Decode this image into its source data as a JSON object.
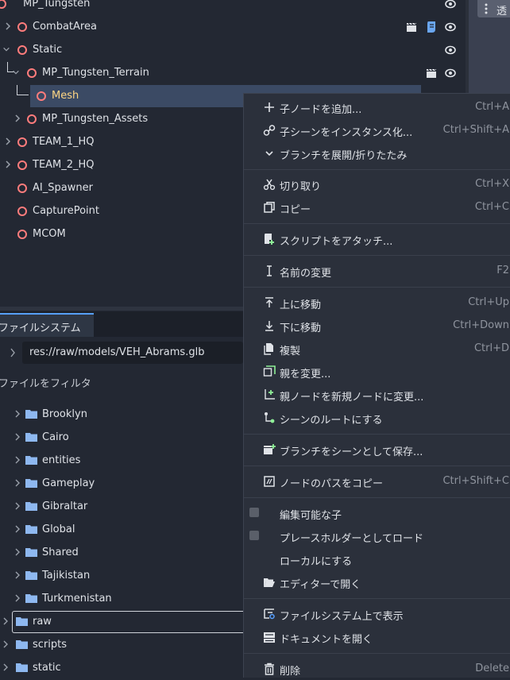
{
  "scene_tree": {
    "nodes": [
      {
        "label": "MP_Tungsten"
      },
      {
        "label": "CombatArea"
      },
      {
        "label": "Static"
      },
      {
        "label": "MP_Tungsten_Terrain"
      },
      {
        "label": "Mesh"
      },
      {
        "label": "MP_Tungsten_Assets"
      },
      {
        "label": "TEAM_1_HQ"
      },
      {
        "label": "TEAM_2_HQ"
      },
      {
        "label": "AI_Spawner"
      },
      {
        "label": "CapturePoint"
      },
      {
        "label": "MCOM"
      }
    ],
    "sliver_tab_label": "透"
  },
  "filesystem": {
    "tab_label": "ファイルシステム",
    "path": "res://raw/models/VEH_Abrams.glb",
    "filter_placeholder": "ファイルをフィルタ",
    "folders": [
      {
        "label": "Brooklyn"
      },
      {
        "label": "Cairo"
      },
      {
        "label": "entities"
      },
      {
        "label": "Gameplay"
      },
      {
        "label": "Gibraltar"
      },
      {
        "label": "Global"
      },
      {
        "label": "Shared"
      },
      {
        "label": "Tajikistan"
      },
      {
        "label": "Turkmenistan"
      },
      {
        "label": "raw"
      },
      {
        "label": "scripts"
      },
      {
        "label": "static"
      }
    ]
  },
  "context_menu": {
    "items": [
      {
        "label": "子ノードを追加...",
        "shortcut": "Ctrl+A",
        "icon": "plus-icon"
      },
      {
        "label": "子シーンをインスタンス化...",
        "shortcut": "Ctrl+Shift+A",
        "icon": "link-icon"
      },
      {
        "label": "ブランチを展開/折りたたみ",
        "shortcut": "",
        "icon": "chevron-down-icon"
      },
      {
        "label": "切り取り",
        "shortcut": "Ctrl+X",
        "icon": "scissors-icon"
      },
      {
        "label": "コピー",
        "shortcut": "Ctrl+C",
        "icon": "copy-icon"
      },
      {
        "label": "スクリプトをアタッチ...",
        "shortcut": "",
        "icon": "script-add-icon"
      },
      {
        "label": "名前の変更",
        "shortcut": "F2",
        "icon": "text-cursor-icon"
      },
      {
        "label": "上に移動",
        "shortcut": "Ctrl+Up",
        "icon": "arrow-up-icon"
      },
      {
        "label": "下に移動",
        "shortcut": "Ctrl+Down",
        "icon": "arrow-down-icon"
      },
      {
        "label": "複製",
        "shortcut": "Ctrl+D",
        "icon": "duplicate-icon"
      },
      {
        "label": "親を変更...",
        "shortcut": "",
        "icon": "reparent-icon"
      },
      {
        "label": "親ノードを新規ノードに変更...",
        "shortcut": "",
        "icon": "reparent-new-icon"
      },
      {
        "label": "シーンのルートにする",
        "shortcut": "",
        "icon": "make-root-icon"
      },
      {
        "label": "ブランチをシーンとして保存...",
        "shortcut": "",
        "icon": "save-branch-icon"
      },
      {
        "label": "ノードのパスをコピー",
        "shortcut": "Ctrl+Shift+C",
        "icon": "copy-path-icon"
      },
      {
        "label": "編集可能な子",
        "shortcut": "",
        "icon": "checkbox"
      },
      {
        "label": "プレースホルダーとしてロード",
        "shortcut": "",
        "icon": "checkbox"
      },
      {
        "label": "ローカルにする",
        "shortcut": "",
        "icon": ""
      },
      {
        "label": "エディターで開く",
        "shortcut": "",
        "icon": "folder-open-icon"
      },
      {
        "label": "ファイルシステム上で表示",
        "shortcut": "",
        "icon": "show-in-fs-icon"
      },
      {
        "label": "ドキュメントを開く",
        "shortcut": "",
        "icon": "doc-icon"
      },
      {
        "label": "削除",
        "shortcut": "Delete",
        "icon": "trash-icon"
      }
    ]
  },
  "colors": {
    "node_icon": "#ff7c7c",
    "selected_row": "#3b4a64",
    "selected_text": "#ffd684",
    "accent": "#57a0ff",
    "folder": "#8eb8f0",
    "green_icon": "#8eef97"
  }
}
